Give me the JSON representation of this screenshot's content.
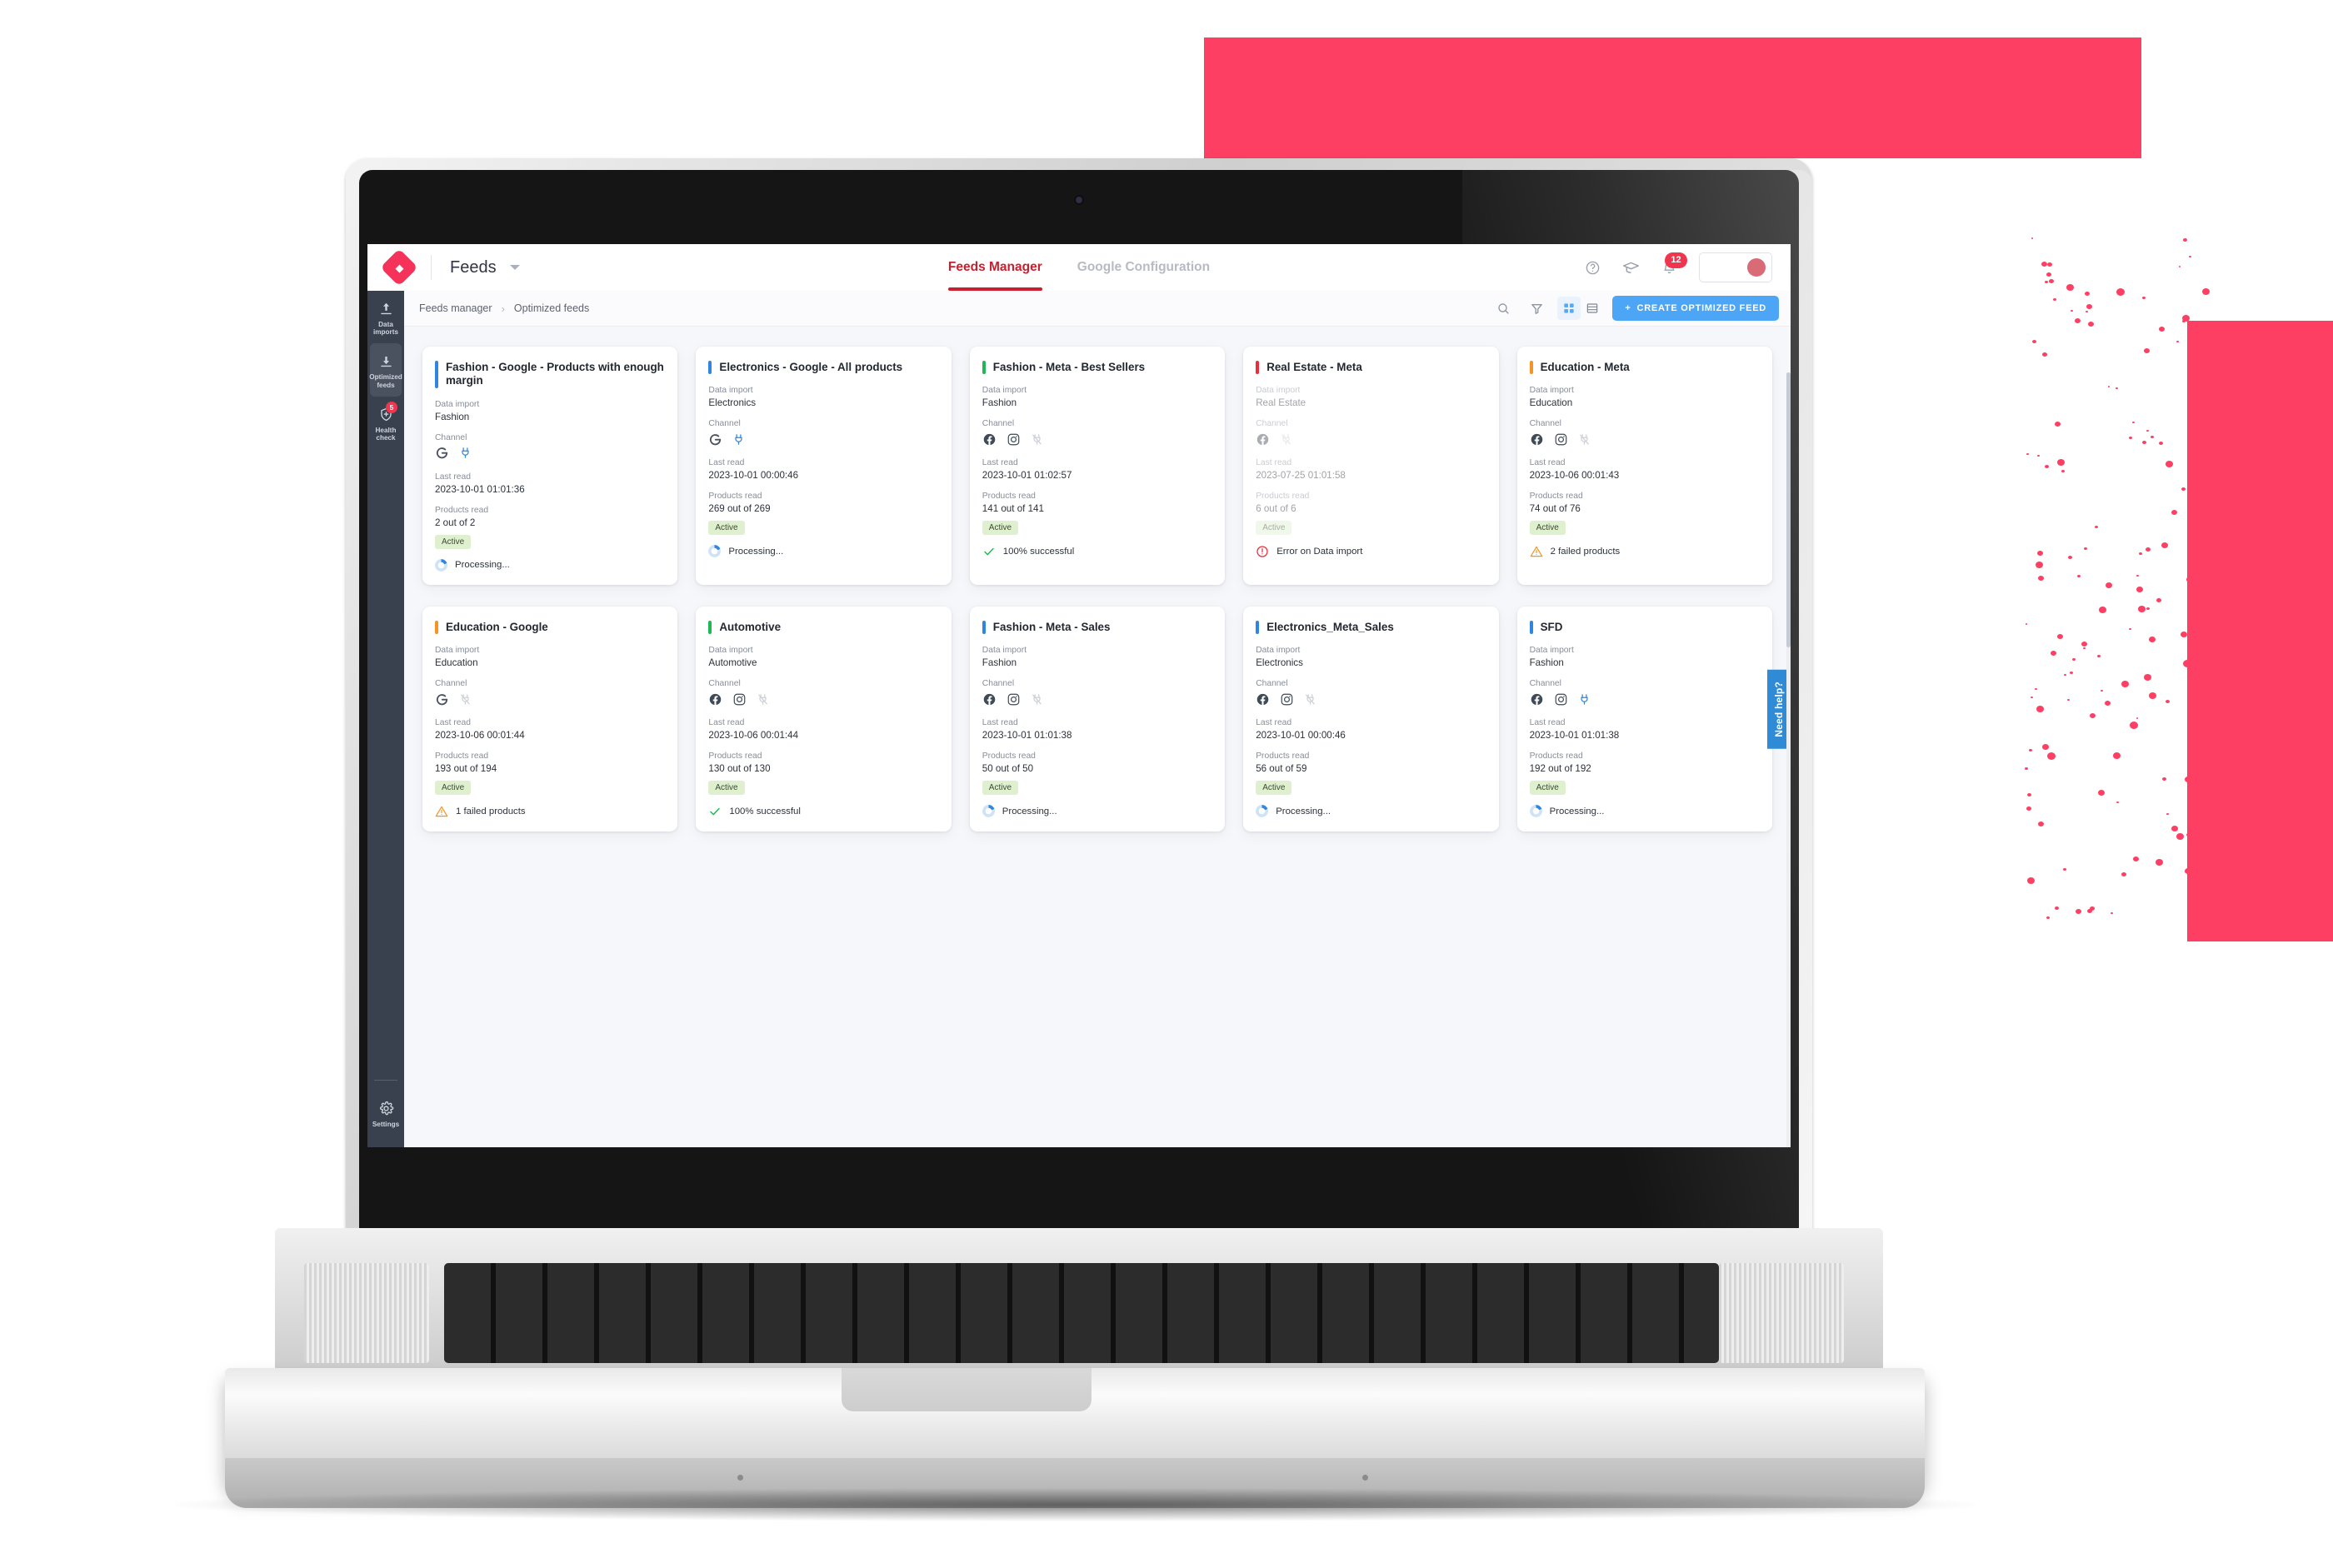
{
  "app": {
    "brand_logo_glyph": "◆",
    "name": "Feeds",
    "dropdown_caret": "chevron-down"
  },
  "tabs": [
    {
      "label": "Feeds Manager",
      "active": true
    },
    {
      "label": "Google Configuration",
      "active": false
    }
  ],
  "top_right": {
    "help_icon": "question-circle-icon",
    "academy_icon": "graduation-cap-icon",
    "notifications_icon": "bell-icon",
    "notifications_count": "12",
    "avatar": "user-avatar"
  },
  "sidebar": {
    "items": [
      {
        "label": "Data\nimports",
        "line1": "Data",
        "line2": "imports",
        "icon": "upload-icon",
        "active": false,
        "badge": ""
      },
      {
        "label": "Optimized feeds",
        "line1": "Optimized",
        "line2": "feeds",
        "icon": "download-icon",
        "active": true,
        "badge": ""
      },
      {
        "label": "Health check",
        "line1": "Health",
        "line2": "check",
        "icon": "shield-plus-icon",
        "active": false,
        "badge": "5"
      }
    ],
    "bottom": {
      "line1": "Settings",
      "line2": "",
      "icon": "gear-icon"
    }
  },
  "breadcrumb": {
    "items": [
      "Feeds manager",
      "Optimized feeds"
    ],
    "separator": "›"
  },
  "toolbar": {
    "search_icon": "search-icon",
    "filter_icon": "filter-icon",
    "grid_view_icon": "grid-view-icon",
    "list_view_icon": "list-view-icon",
    "create_label": "CREATE OPTIMIZED FEED",
    "create_plus": "+",
    "accent_blue": "#4da6f5"
  },
  "labels": {
    "data_import": "Data import",
    "channel": "Channel",
    "last_read": "Last read",
    "products_read": "Products read"
  },
  "colors": {
    "brand_red": "#f4325a",
    "tab_red": "#c8202f",
    "accent_blue": "#2f86e0",
    "accent_green": "#1db954",
    "accent_orange": "#f59324",
    "accent_red": "#ef2b3a",
    "sidebar_bg": "#39414e",
    "deco_pink": "#fc3f63"
  },
  "need_help": {
    "label": "Need help?"
  },
  "cards": [
    {
      "title": "Fashion - Google - Products with enough margin",
      "accent": "#2f86e0",
      "data_import": "Fashion",
      "channels": [
        "google-icon",
        "plug-icon"
      ],
      "last_read": "2023-10-01 01:01:36",
      "products_read": "2 out of 2",
      "status_badge": "Active",
      "state_text": "Processing...",
      "state_icon": "spinner-icon",
      "dimmed": false
    },
    {
      "title": "Electronics - Google - All products",
      "accent": "#2f86e0",
      "data_import": "Electronics",
      "channels": [
        "google-icon",
        "plug-icon"
      ],
      "last_read": "2023-10-01 00:00:46",
      "products_read": "269 out of 269",
      "status_badge": "Active",
      "state_text": "Processing...",
      "state_icon": "spinner-icon",
      "dimmed": false
    },
    {
      "title": "Fashion - Meta - Best Sellers",
      "accent": "#1db954",
      "data_import": "Fashion",
      "channels": [
        "facebook-icon",
        "instagram-icon",
        "plug-off-icon"
      ],
      "last_read": "2023-10-01 01:02:57",
      "products_read": "141 out of 141",
      "status_badge": "Active",
      "state_text": "100% successful",
      "state_icon": "check-icon",
      "dimmed": false
    },
    {
      "title": "Real Estate - Meta",
      "accent": "#ef2b3a",
      "data_import": "Real Estate",
      "channels": [
        "facebook-icon",
        "plug-off-icon"
      ],
      "last_read": "2023-07-25 01:01:58",
      "products_read": "6 out of 6",
      "status_badge": "Active",
      "state_text": "Error on Data import",
      "state_icon": "error-icon",
      "dimmed": true
    },
    {
      "title": "Education - Meta",
      "accent": "#f59324",
      "data_import": "Education",
      "channels": [
        "facebook-icon",
        "instagram-icon",
        "plug-off-icon"
      ],
      "last_read": "2023-10-06 00:01:43",
      "products_read": "74 out of 76",
      "status_badge": "Active",
      "state_text": "2 failed products",
      "state_icon": "warning-icon",
      "dimmed": false
    },
    {
      "title": "Education - Google",
      "accent": "#f59324",
      "data_import": "Education",
      "channels": [
        "google-icon",
        "plug-off-icon"
      ],
      "last_read": "2023-10-06 00:01:44",
      "products_read": "193 out of 194",
      "status_badge": "Active",
      "state_text": "1 failed products",
      "state_icon": "warning-icon",
      "dimmed": false
    },
    {
      "title": "Automotive",
      "accent": "#1db954",
      "data_import": "Automotive",
      "channels": [
        "facebook-icon",
        "instagram-icon",
        "plug-off-icon"
      ],
      "last_read": "2023-10-06 00:01:44",
      "products_read": "130 out of 130",
      "status_badge": "Active",
      "state_text": "100% successful",
      "state_icon": "check-icon",
      "dimmed": false
    },
    {
      "title": "Fashion - Meta - Sales",
      "accent": "#2f86e0",
      "data_import": "Fashion",
      "channels": [
        "facebook-icon",
        "instagram-icon",
        "plug-off-icon"
      ],
      "last_read": "2023-10-01 01:01:38",
      "products_read": "50 out of 50",
      "status_badge": "Active",
      "state_text": "Processing...",
      "state_icon": "spinner-icon",
      "dimmed": false
    },
    {
      "title": "Electronics_Meta_Sales",
      "accent": "#2f86e0",
      "data_import": "Electronics",
      "channels": [
        "facebook-icon",
        "instagram-icon",
        "plug-off-icon"
      ],
      "last_read": "2023-10-01 00:00:46",
      "products_read": "56 out of 59",
      "status_badge": "Active",
      "state_text": "Processing...",
      "state_icon": "spinner-icon",
      "dimmed": false
    },
    {
      "title": "SFD",
      "accent": "#2f86e0",
      "data_import": "Fashion",
      "channels": [
        "facebook-icon",
        "instagram-icon",
        "plug-icon"
      ],
      "last_read": "2023-10-01 01:01:38",
      "products_read": "192 out of 192",
      "status_badge": "Active",
      "state_text": "Processing...",
      "state_icon": "spinner-icon",
      "dimmed": false
    }
  ]
}
